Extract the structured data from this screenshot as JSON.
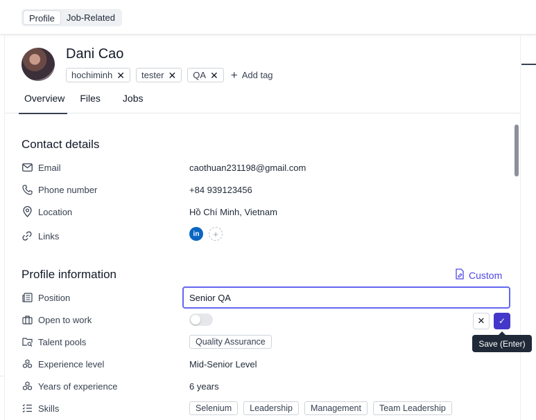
{
  "top_tabs": [
    {
      "label": "Profile",
      "active": true
    },
    {
      "label": "Job-Related",
      "active": false
    }
  ],
  "candidate": {
    "name": "Dani Cao",
    "tags": [
      "hochiminh",
      "tester",
      "QA"
    ],
    "add_tag_label": "Add tag"
  },
  "sub_tabs": [
    {
      "label": "Overview",
      "active": true
    },
    {
      "label": "Files",
      "active": false
    },
    {
      "label": "Jobs",
      "active": false
    }
  ],
  "contact": {
    "title": "Contact details",
    "email_label": "Email",
    "email": "caothuan231198@gmail.com",
    "phone_label": "Phone number",
    "phone": "+84 939123456",
    "location_label": "Location",
    "location": "Hồ Chí Minh, Vietnam",
    "links_label": "Links",
    "linkedin_text": "in"
  },
  "profile": {
    "title": "Profile information",
    "custom_label": "Custom",
    "position_label": "Position",
    "position_value": "Senior QA",
    "open_to_work_label": "Open to work",
    "open_to_work": false,
    "talent_pools_label": "Talent pools",
    "talent_pools": [
      "Quality Assurance"
    ],
    "experience_level_label": "Experience level",
    "experience_level": "Mid-Senior Level",
    "years_label": "Years of experience",
    "years": "6 years",
    "skills_label": "Skills",
    "skills": [
      "Selenium",
      "Leadership",
      "Management",
      "Team Leadership"
    ]
  },
  "actions": {
    "cancel_symbol": "✕",
    "save_symbol": "✓",
    "save_tooltip": "Save (Enter)"
  },
  "colors": {
    "accent": "#4f46e5",
    "save_button": "#4338ca",
    "linkedin": "#0a66c2"
  }
}
